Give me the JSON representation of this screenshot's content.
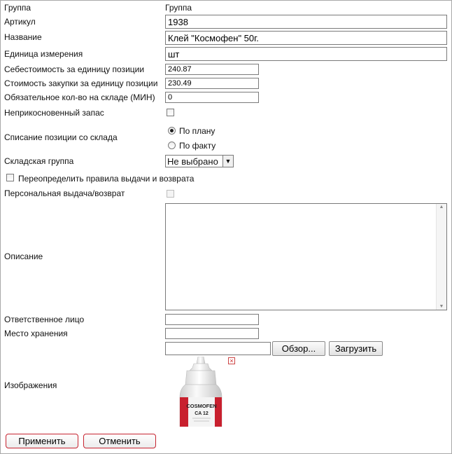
{
  "form": {
    "group": {
      "label": "Группа",
      "value": "Группа"
    },
    "article": {
      "label": "Артикул",
      "value": "1938"
    },
    "name": {
      "label": "Название",
      "value": "Клей \"Космофен\" 50г."
    },
    "unit": {
      "label": "Единица измерения",
      "value": "шт"
    },
    "cost_price": {
      "label": "Себестоимость за единицу позиции",
      "value": "240.87"
    },
    "purchase_price": {
      "label": "Стоимость закупки за единицу позиции",
      "value": "230.49"
    },
    "min_stock": {
      "label": "Обязательное кол-во на складе (МИН)",
      "value": "0"
    },
    "reserve": {
      "label": "Неприкосновенный запас",
      "checked": false
    },
    "writeoff": {
      "label": "Списание позиции со склада",
      "options": [
        "По плану",
        "По факту"
      ],
      "selected": "По плану"
    },
    "warehouse_group": {
      "label": "Складская группа",
      "value": "Не выбрано"
    },
    "override_rules": {
      "label": "Переопределить правила выдачи и возврата",
      "checked": false
    },
    "personal_issue": {
      "label": "Персональная выдача/возврат",
      "checked": false,
      "disabled": true
    },
    "description": {
      "label": "Описание",
      "value": ""
    },
    "responsible": {
      "label": "Ответственное лицо",
      "value": ""
    },
    "storage_place": {
      "label": "Место хранения",
      "value": ""
    },
    "images": {
      "label": "Изображения",
      "browse_label": "Обзор...",
      "upload_label": "Загрузить",
      "delete_icon": "close-icon",
      "product_label_line1": "COSMOFEN",
      "product_label_line2": "CA 12"
    }
  },
  "actions": {
    "apply_label": "Применить",
    "cancel_label": "Отменить"
  },
  "colors": {
    "button_border": "#c6232f",
    "bottle_label": "#c8202e"
  }
}
